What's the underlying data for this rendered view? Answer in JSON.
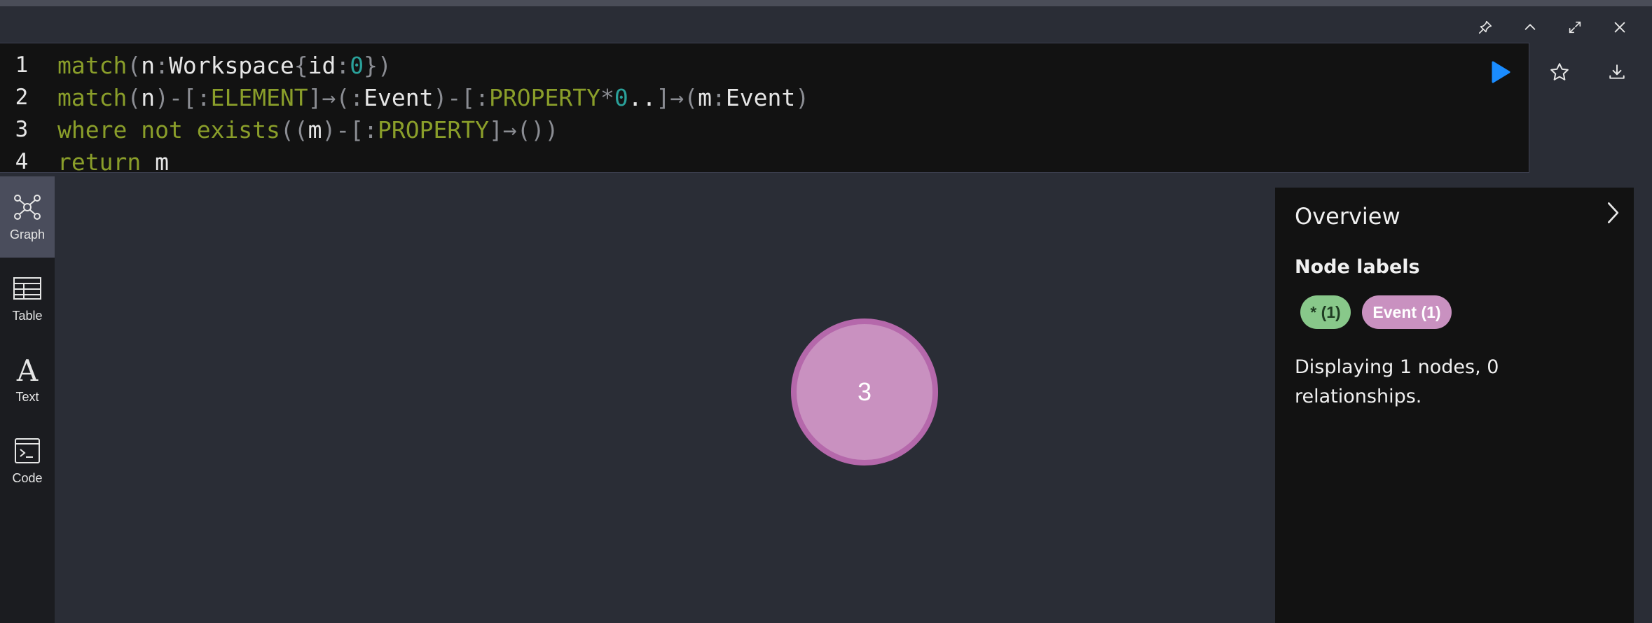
{
  "editor": {
    "lines": [
      {
        "num": "1"
      },
      {
        "num": "2"
      },
      {
        "num": "3"
      },
      {
        "num": "4"
      }
    ],
    "tokens": {
      "l1_match": "match",
      "l1_p1": "(",
      "l1_n": "n",
      "l1_c1": ":",
      "l1_ws": "Workspace",
      "l1_b1": "{",
      "l1_id": "id",
      "l1_c2": ":",
      "l1_zero": "0",
      "l1_b2": "}",
      "l1_p2": ")",
      "l2_match": "match",
      "l2_p1": "(",
      "l2_n": "n",
      "l2_p2": ")",
      "l2_d1": "-",
      "l2_s1": "[",
      "l2_c1": ":",
      "l2_el": "ELEMENT",
      "l2_s2": "]",
      "l2_a1": "→",
      "l2_p3": "(",
      "l2_c2": ":",
      "l2_ev": "Event",
      "l2_p4": ")",
      "l2_d2": "-",
      "l2_s3": "[",
      "l2_c3": ":",
      "l2_prop": "PROPERTY",
      "l2_star": "*",
      "l2_zero": "0",
      "l2_dots": "..",
      "l2_s4": "]",
      "l2_a2": "→",
      "l2_p5": "(",
      "l2_m": "m",
      "l2_c4": ":",
      "l2_ev2": "Event",
      "l2_p6": ")",
      "l3_where": "where",
      "l3_not": "not",
      "l3_exists": "exists",
      "l3_p1": "((",
      "l3_m": "m",
      "l3_p2": ")",
      "l3_d1": "-",
      "l3_s1": "[",
      "l3_c1": ":",
      "l3_prop": "PROPERTY",
      "l3_s2": "]",
      "l3_a1": "→",
      "l3_p3": "())",
      "l4_return": "return",
      "l4_m": "m"
    }
  },
  "frame_controls": {
    "pin": "pin-icon",
    "collapse": "chevron-up-icon",
    "fullscreen": "expand-icon",
    "close": "close-icon"
  },
  "actions": {
    "run": "play-icon",
    "favorite": "star-icon",
    "download": "download-icon"
  },
  "sidebar": {
    "items": [
      {
        "label": "Graph",
        "icon": "graph-icon",
        "active": true
      },
      {
        "label": "Table",
        "icon": "table-icon",
        "active": false
      },
      {
        "label": "Text",
        "icon": "text-icon",
        "active": false
      },
      {
        "label": "Code",
        "icon": "code-icon",
        "active": false
      }
    ]
  },
  "graph": {
    "node_label": "3",
    "node_color": "#c991c0",
    "node_border": "#b568ab"
  },
  "overview": {
    "title": "Overview",
    "section": "Node labels",
    "chips": [
      {
        "label": "* (1)",
        "color": "#88c88a"
      },
      {
        "label": "Event (1)",
        "color": "#c991c0"
      }
    ],
    "summary": "Displaying 1 nodes, 0 relationships."
  },
  "colors": {
    "background": "#2a2d36",
    "editor_bg": "#121212",
    "keyword": "#8a9e2a",
    "number": "#2aa19a",
    "run_accent": "#1a8cff"
  }
}
